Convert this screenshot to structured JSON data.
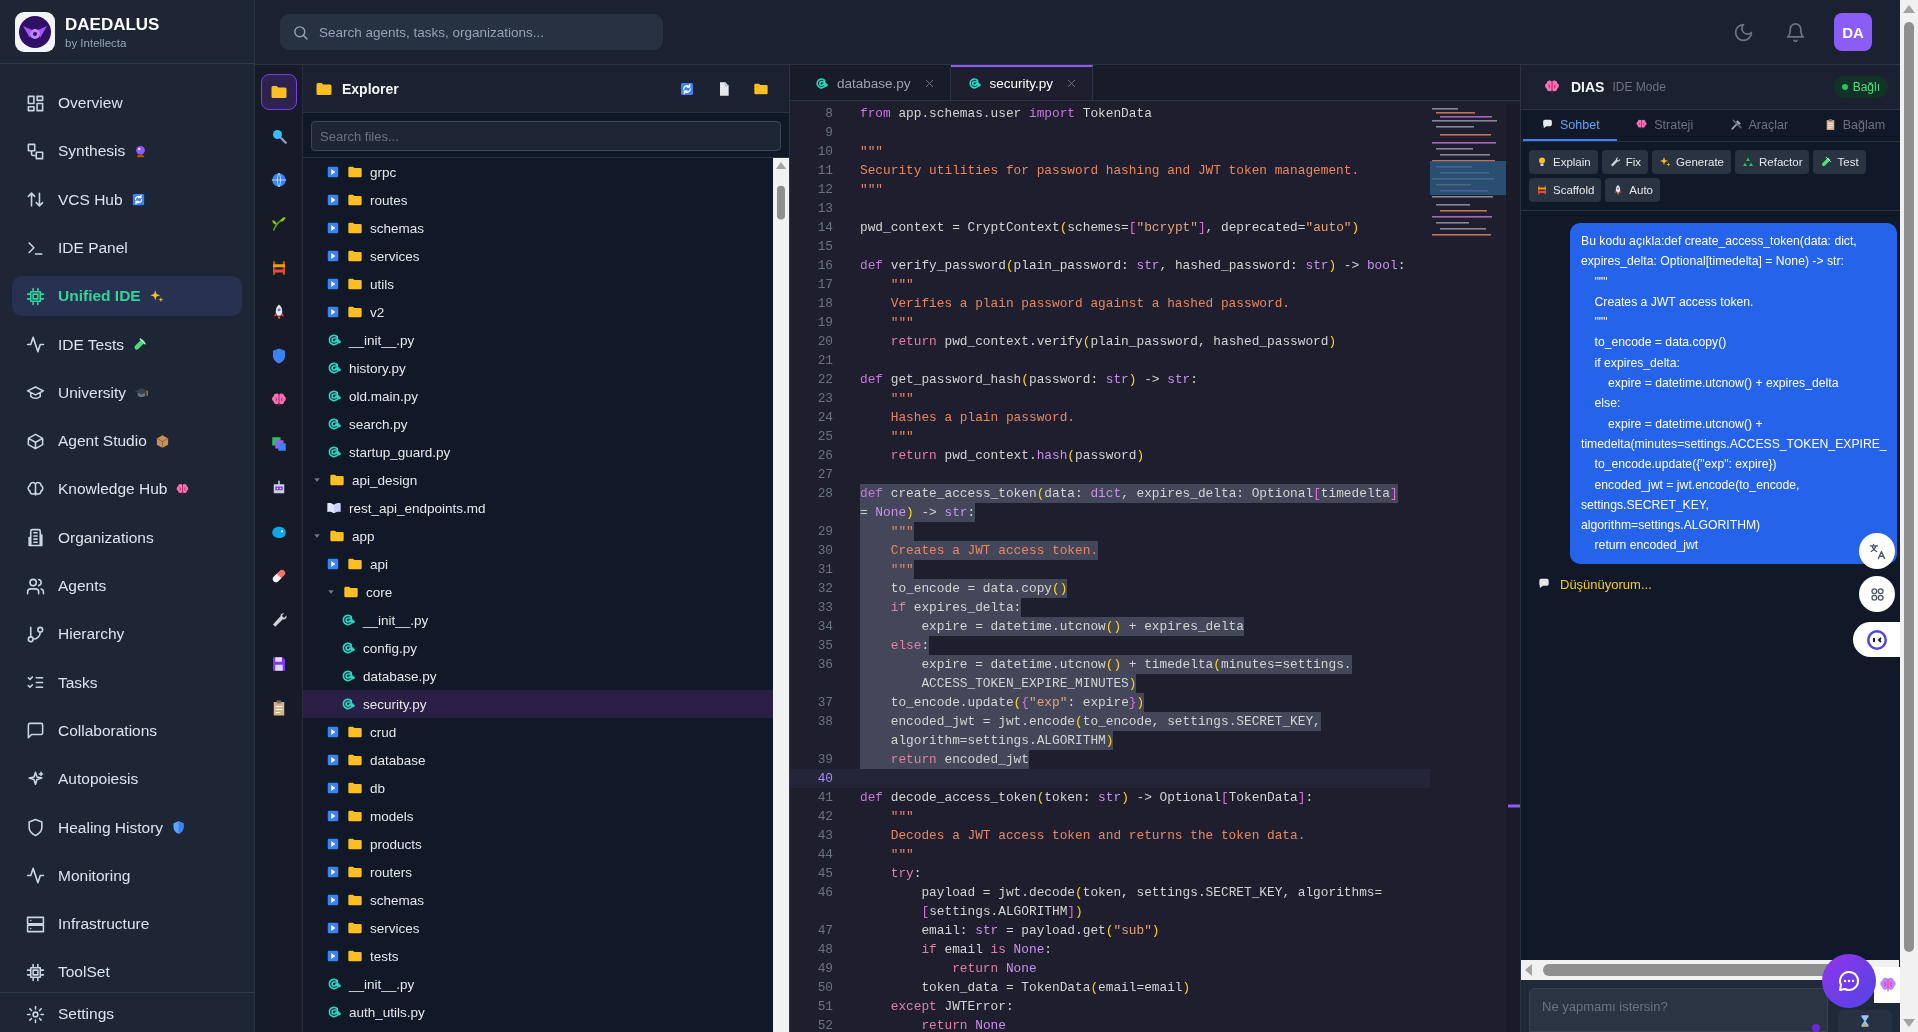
{
  "brand": {
    "name": "DAEDALUS",
    "tagline": "by Intellecta"
  },
  "nav": [
    {
      "label": "Overview",
      "selected": false
    },
    {
      "label": "Synthesis",
      "selected": false
    },
    {
      "label": "VCS Hub",
      "selected": false
    },
    {
      "label": "IDE Panel",
      "selected": false
    },
    {
      "label": "Unified IDE",
      "selected": true
    },
    {
      "label": "IDE Tests",
      "selected": false
    },
    {
      "label": "University",
      "selected": false
    },
    {
      "label": "Agent Studio",
      "selected": false
    },
    {
      "label": "Knowledge Hub",
      "selected": false
    },
    {
      "label": "Organizations",
      "selected": false
    },
    {
      "label": "Agents",
      "selected": false
    },
    {
      "label": "Hierarchy",
      "selected": false
    },
    {
      "label": "Tasks",
      "selected": false
    },
    {
      "label": "Collaborations",
      "selected": false
    },
    {
      "label": "Autopoiesis",
      "selected": false
    },
    {
      "label": "Healing History",
      "selected": false
    },
    {
      "label": "Monitoring",
      "selected": false
    },
    {
      "label": "Infrastructure",
      "selected": false
    },
    {
      "label": "ToolSet",
      "selected": false
    }
  ],
  "settings": {
    "label": "Settings"
  },
  "search": {
    "placeholder": "Search agents, tasks, organizations..."
  },
  "user": {
    "initials": "DA"
  },
  "activity_bar": [
    {
      "selected": true
    },
    {
      "selected": false
    },
    {
      "selected": false
    },
    {
      "selected": false
    },
    {
      "selected": false
    },
    {
      "selected": false
    },
    {
      "selected": false
    },
    {
      "selected": false
    },
    {
      "selected": false
    },
    {
      "selected": false
    },
    {
      "selected": false
    },
    {
      "selected": false
    },
    {
      "selected": false
    },
    {
      "selected": false
    },
    {
      "selected": false
    }
  ],
  "explorer": {
    "title": "Explorer",
    "search": {
      "placeholder": "Search files..."
    },
    "tree_continued": [
      {
        "name": "grpc",
        "kind": "folder",
        "expanded": false,
        "selected": false
      },
      {
        "name": "routes",
        "kind": "folder",
        "expanded": false,
        "selected": false
      },
      {
        "name": "schemas",
        "kind": "folder",
        "expanded": false,
        "selected": false
      },
      {
        "name": "services",
        "kind": "folder",
        "expanded": false,
        "selected": false
      },
      {
        "name": "utils",
        "kind": "folder",
        "expanded": false,
        "selected": false
      },
      {
        "name": "v2",
        "kind": "folder",
        "expanded": false,
        "selected": false
      },
      {
        "name": "__init__.py",
        "kind": "python",
        "selected": false
      },
      {
        "name": "history.py",
        "kind": "python",
        "selected": false
      },
      {
        "name": "old.main.py",
        "kind": "python",
        "selected": false
      },
      {
        "name": "search.py",
        "kind": "python",
        "selected": false
      },
      {
        "name": "startup_guard.py",
        "kind": "python",
        "selected": false
      }
    ],
    "tree": [
      {
        "name": "api_design",
        "kind": "folder",
        "expanded": true,
        "selected": false,
        "children": [
          {
            "name": "rest_api_endpoints.md",
            "kind": "markdown",
            "selected": false
          }
        ]
      },
      {
        "name": "app",
        "kind": "folder",
        "expanded": true,
        "selected": false,
        "children": [
          {
            "name": "api",
            "kind": "folder",
            "expanded": false,
            "selected": false
          },
          {
            "name": "core",
            "kind": "folder",
            "expanded": true,
            "selected": false,
            "children": [
              {
                "name": "__init__.py",
                "kind": "python",
                "selected": false
              },
              {
                "name": "config.py",
                "kind": "python",
                "selected": false
              },
              {
                "name": "database.py",
                "kind": "python",
                "selected": false
              },
              {
                "name": "security.py",
                "kind": "python",
                "selected": true
              }
            ]
          },
          {
            "name": "crud",
            "kind": "folder",
            "expanded": false,
            "selected": false
          },
          {
            "name": "database",
            "kind": "folder",
            "expanded": false,
            "selected": false
          },
          {
            "name": "db",
            "kind": "folder",
            "expanded": false,
            "selected": false
          },
          {
            "name": "models",
            "kind": "folder",
            "expanded": false,
            "selected": false
          },
          {
            "name": "products",
            "kind": "folder",
            "expanded": false,
            "selected": false
          },
          {
            "name": "routers",
            "kind": "folder",
            "expanded": false,
            "selected": false
          },
          {
            "name": "schemas",
            "kind": "folder",
            "expanded": false,
            "selected": false
          },
          {
            "name": "services",
            "kind": "folder",
            "expanded": false,
            "selected": false
          },
          {
            "name": "tests",
            "kind": "folder",
            "expanded": false,
            "selected": false
          },
          {
            "name": "__init__.py",
            "kind": "python",
            "selected": false
          },
          {
            "name": "auth_utils.py",
            "kind": "python",
            "selected": false
          }
        ]
      }
    ]
  },
  "editor": {
    "tabs": [
      {
        "label": "database.py",
        "selected": false
      },
      {
        "label": "security.py",
        "selected": true
      }
    ],
    "lines": [
      {
        "number": "8",
        "selected": false,
        "current": false,
        "tokens": [
          {
            "kind": "keyword",
            "text": "from"
          },
          {
            "kind": "plain",
            "text": " app.schemas.user "
          },
          {
            "kind": "keyword",
            "text": "import"
          },
          {
            "kind": "plain",
            "text": " TokenData"
          }
        ]
      },
      {
        "number": "9",
        "selected": false,
        "current": false
      },
      {
        "number": "10",
        "selected": false,
        "current": false,
        "tokens": [
          {
            "kind": "docstring",
            "text": "\"\"\""
          }
        ]
      },
      {
        "number": "11",
        "selected": false,
        "current": false,
        "tokens": [
          {
            "kind": "docstring",
            "text": "Security utilities for password hashing and JWT token management."
          }
        ]
      },
      {
        "number": "12",
        "selected": false,
        "current": false,
        "tokens": [
          {
            "kind": "docstring",
            "text": "\"\"\""
          }
        ]
      },
      {
        "number": "13",
        "selected": false,
        "current": false
      },
      {
        "number": "14",
        "selected": false,
        "current": false,
        "tokens": [
          {
            "kind": "plain",
            "text": "pwd_context = CryptContext"
          },
          {
            "kind": "paren",
            "text": "("
          },
          {
            "kind": "plain",
            "text": "schemes="
          },
          {
            "kind": "bracket",
            "text": "["
          },
          {
            "kind": "string",
            "text": "\"bcrypt\""
          },
          {
            "kind": "bracket",
            "text": "]"
          },
          {
            "kind": "plain",
            "text": ", deprecated="
          },
          {
            "kind": "string",
            "text": "\"auto\""
          },
          {
            "kind": "paren",
            "text": ")"
          }
        ]
      },
      {
        "number": "15",
        "selected": false,
        "current": false
      },
      {
        "number": "16",
        "selected": false,
        "current": false,
        "tokens": [
          {
            "kind": "keyword",
            "text": "def"
          },
          {
            "kind": "plain",
            "text": " verify_password"
          },
          {
            "kind": "paren",
            "text": "("
          },
          {
            "kind": "plain",
            "text": "plain_password: "
          },
          {
            "kind": "type",
            "text": "str"
          },
          {
            "kind": "plain",
            "text": ", hashed_password: "
          },
          {
            "kind": "type",
            "text": "str"
          },
          {
            "kind": "paren",
            "text": ")"
          },
          {
            "kind": "plain",
            "text": " -> "
          },
          {
            "kind": "type",
            "text": "bool"
          },
          {
            "kind": "plain",
            "text": ":"
          }
        ]
      },
      {
        "number": "17",
        "selected": false,
        "current": false,
        "tokens": [
          {
            "kind": "docstring",
            "text": "    \"\"\""
          }
        ]
      },
      {
        "number": "18",
        "selected": false,
        "current": false,
        "tokens": [
          {
            "kind": "docstring",
            "text": "    Verifies a plain password against a hashed password."
          }
        ]
      },
      {
        "number": "19",
        "selected": false,
        "current": false,
        "tokens": [
          {
            "kind": "docstring",
            "text": "    \"\"\""
          }
        ]
      },
      {
        "number": "20",
        "selected": false,
        "current": false,
        "tokens": [
          {
            "kind": "control",
            "text": "    return"
          },
          {
            "kind": "plain",
            "text": " pwd_context.verify"
          },
          {
            "kind": "paren",
            "text": "("
          },
          {
            "kind": "plain",
            "text": "plain_password, hashed_password"
          },
          {
            "kind": "paren",
            "text": ")"
          }
        ]
      },
      {
        "number": "21",
        "selected": false,
        "current": false
      },
      {
        "number": "22",
        "selected": false,
        "current": false,
        "tokens": [
          {
            "kind": "keyword",
            "text": "def"
          },
          {
            "kind": "plain",
            "text": " get_password_hash"
          },
          {
            "kind": "paren",
            "text": "("
          },
          {
            "kind": "plain",
            "text": "password: "
          },
          {
            "kind": "type",
            "text": "str"
          },
          {
            "kind": "paren",
            "text": ")"
          },
          {
            "kind": "plain",
            "text": " -> "
          },
          {
            "kind": "type",
            "text": "str"
          },
          {
            "kind": "plain",
            "text": ":"
          }
        ]
      },
      {
        "number": "23",
        "selected": false,
        "current": false,
        "tokens": [
          {
            "kind": "docstring",
            "text": "    \"\"\""
          }
        ]
      },
      {
        "number": "24",
        "selected": false,
        "current": false,
        "tokens": [
          {
            "kind": "docstring",
            "text": "    Hashes a plain password."
          }
        ]
      },
      {
        "number": "25",
        "selected": false,
        "current": false,
        "tokens": [
          {
            "kind": "docstring",
            "text": "    \"\"\""
          }
        ]
      },
      {
        "number": "26",
        "selected": false,
        "current": false,
        "tokens": [
          {
            "kind": "control",
            "text": "    return"
          },
          {
            "kind": "plain",
            "text": " pwd_context."
          },
          {
            "kind": "type",
            "text": "hash"
          },
          {
            "kind": "paren",
            "text": "("
          },
          {
            "kind": "plain",
            "text": "password"
          },
          {
            "kind": "paren",
            "text": ")"
          }
        ]
      },
      {
        "number": "27",
        "selected": false,
        "current": false
      },
      {
        "number": "28",
        "selected": true,
        "current": false,
        "tokens": [
          {
            "kind": "keyword",
            "text": "def"
          },
          {
            "kind": "plain",
            "text": " create_access_token"
          },
          {
            "kind": "paren",
            "text": "("
          },
          {
            "kind": "plain",
            "text": "data: "
          },
          {
            "kind": "type",
            "text": "dict"
          },
          {
            "kind": "plain",
            "text": ", expires_delta: Optional"
          },
          {
            "kind": "bracket",
            "text": "["
          },
          {
            "kind": "plain",
            "text": "timedelta"
          },
          {
            "kind": "bracket",
            "text": "]"
          }
        ],
        "continuation": [
          {
            "kind": "plain",
            "text": "= "
          },
          {
            "kind": "type",
            "text": "None"
          },
          {
            "kind": "paren",
            "text": ")"
          },
          {
            "kind": "plain",
            "text": " -> "
          },
          {
            "kind": "type",
            "text": "str"
          },
          {
            "kind": "plain",
            "text": ":"
          }
        ]
      },
      {
        "number": "29",
        "selected": true,
        "current": false,
        "tokens": [
          {
            "kind": "docstring",
            "text": "    \"\"\""
          }
        ]
      },
      {
        "number": "30",
        "selected": true,
        "current": false,
        "tokens": [
          {
            "kind": "docstring",
            "text": "    Creates a JWT access token."
          }
        ]
      },
      {
        "number": "31",
        "selected": true,
        "current": false,
        "tokens": [
          {
            "kind": "docstring",
            "text": "    \"\"\""
          }
        ]
      },
      {
        "number": "32",
        "selected": true,
        "current": false,
        "tokens": [
          {
            "kind": "plain",
            "text": "    to_encode = data.copy"
          },
          {
            "kind": "paren",
            "text": "()"
          }
        ]
      },
      {
        "number": "33",
        "selected": true,
        "current": false,
        "tokens": [
          {
            "kind": "control",
            "text": "    if"
          },
          {
            "kind": "plain",
            "text": " expires_delta:"
          }
        ]
      },
      {
        "number": "34",
        "selected": true,
        "current": false,
        "tokens": [
          {
            "kind": "plain",
            "text": "        expire = datetime.utcnow"
          },
          {
            "kind": "paren",
            "text": "()"
          },
          {
            "kind": "plain",
            "text": " + expires_delta"
          }
        ]
      },
      {
        "number": "35",
        "selected": true,
        "current": false,
        "tokens": [
          {
            "kind": "control",
            "text": "    else"
          },
          {
            "kind": "plain",
            "text": ":"
          }
        ]
      },
      {
        "number": "36",
        "selected": true,
        "current": false,
        "tokens": [
          {
            "kind": "plain",
            "text": "        expire = datetime.utcnow"
          },
          {
            "kind": "paren",
            "text": "()"
          },
          {
            "kind": "plain",
            "text": " + timedelta"
          },
          {
            "kind": "paren",
            "text": "("
          },
          {
            "kind": "plain",
            "text": "minutes=settings."
          }
        ],
        "continuation": [
          {
            "kind": "plain",
            "text": "        ACCESS_TOKEN_EXPIRE_MINUTES"
          },
          {
            "kind": "paren",
            "text": ")"
          }
        ]
      },
      {
        "number": "37",
        "selected": true,
        "current": false,
        "tokens": [
          {
            "kind": "plain",
            "text": "    to_encode.update"
          },
          {
            "kind": "paren",
            "text": "("
          },
          {
            "kind": "bracket",
            "text": "{"
          },
          {
            "kind": "string",
            "text": "\"exp\""
          },
          {
            "kind": "plain",
            "text": ": expire"
          },
          {
            "kind": "bracket",
            "text": "}"
          },
          {
            "kind": "paren",
            "text": ")"
          }
        ]
      },
      {
        "number": "38",
        "selected": true,
        "current": false,
        "tokens": [
          {
            "kind": "plain",
            "text": "    encoded_jwt = jwt.encode"
          },
          {
            "kind": "paren",
            "text": "("
          },
          {
            "kind": "plain",
            "text": "to_encode, settings.SECRET_KEY,"
          }
        ],
        "continuation": [
          {
            "kind": "plain",
            "text": "    algorithm=settings.ALGORITHM"
          },
          {
            "kind": "paren",
            "text": ")"
          }
        ]
      },
      {
        "number": "39",
        "selected": true,
        "current": false,
        "tokens": [
          {
            "kind": "control",
            "text": "    return"
          },
          {
            "kind": "plain",
            "text": " encoded_jwt"
          }
        ]
      },
      {
        "number": "40",
        "selected": false,
        "current": true
      },
      {
        "number": "41",
        "selected": false,
        "current": false,
        "tokens": [
          {
            "kind": "keyword",
            "text": "def"
          },
          {
            "kind": "plain",
            "text": " decode_access_token"
          },
          {
            "kind": "paren",
            "text": "("
          },
          {
            "kind": "plain",
            "text": "token: "
          },
          {
            "kind": "type",
            "text": "str"
          },
          {
            "kind": "paren",
            "text": ")"
          },
          {
            "kind": "plain",
            "text": " -> Optional"
          },
          {
            "kind": "bracket",
            "text": "["
          },
          {
            "kind": "plain",
            "text": "TokenData"
          },
          {
            "kind": "bracket",
            "text": "]"
          },
          {
            "kind": "plain",
            "text": ":"
          }
        ]
      },
      {
        "number": "42",
        "selected": false,
        "current": false,
        "tokens": [
          {
            "kind": "docstring",
            "text": "    \"\"\""
          }
        ]
      },
      {
        "number": "43",
        "selected": false,
        "current": false,
        "tokens": [
          {
            "kind": "docstring",
            "text": "    Decodes a JWT access token and returns the token data."
          }
        ]
      },
      {
        "number": "44",
        "selected": false,
        "current": false,
        "tokens": [
          {
            "kind": "docstring",
            "text": "    \"\"\""
          }
        ]
      },
      {
        "number": "45",
        "selected": false,
        "current": false,
        "tokens": [
          {
            "kind": "control",
            "text": "    try"
          },
          {
            "kind": "plain",
            "text": ":"
          }
        ]
      },
      {
        "number": "46",
        "selected": false,
        "current": false,
        "tokens": [
          {
            "kind": "plain",
            "text": "        payload = jwt.decode"
          },
          {
            "kind": "paren",
            "text": "("
          },
          {
            "kind": "plain",
            "text": "token, settings.SECRET_KEY, algorithms="
          }
        ],
        "continuation": [
          {
            "kind": "bracket",
            "text": "        ["
          },
          {
            "kind": "plain",
            "text": "settings.ALGORITHM"
          },
          {
            "kind": "bracket",
            "text": "]"
          },
          {
            "kind": "paren",
            "text": ")"
          }
        ]
      },
      {
        "number": "47",
        "selected": false,
        "current": false,
        "tokens": [
          {
            "kind": "plain",
            "text": "        email: "
          },
          {
            "kind": "type",
            "text": "str"
          },
          {
            "kind": "plain",
            "text": " = payload.get"
          },
          {
            "kind": "paren",
            "text": "("
          },
          {
            "kind": "string",
            "text": "\"sub\""
          },
          {
            "kind": "paren",
            "text": ")"
          }
        ]
      },
      {
        "number": "48",
        "selected": false,
        "current": false,
        "tokens": [
          {
            "kind": "control",
            "text": "        if"
          },
          {
            "kind": "plain",
            "text": " email "
          },
          {
            "kind": "control",
            "text": "is "
          },
          {
            "kind": "type",
            "text": "None"
          },
          {
            "kind": "plain",
            "text": ":"
          }
        ]
      },
      {
        "number": "49",
        "selected": false,
        "current": false,
        "tokens": [
          {
            "kind": "control",
            "text": "            return "
          },
          {
            "kind": "type",
            "text": "None"
          }
        ]
      },
      {
        "number": "50",
        "selected": false,
        "current": false,
        "tokens": [
          {
            "kind": "plain",
            "text": "        token_data = TokenData"
          },
          {
            "kind": "paren",
            "text": "("
          },
          {
            "kind": "plain",
            "text": "email=email"
          },
          {
            "kind": "paren",
            "text": ")"
          }
        ]
      },
      {
        "number": "51",
        "selected": false,
        "current": false,
        "tokens": [
          {
            "kind": "control",
            "text": "    except"
          },
          {
            "kind": "plain",
            "text": " JWTError:"
          }
        ]
      },
      {
        "number": "52",
        "selected": false,
        "current": false,
        "tokens": [
          {
            "kind": "control",
            "text": "        return "
          },
          {
            "kind": "type",
            "text": "None"
          }
        ]
      }
    ]
  },
  "assistant": {
    "name": "DIAS",
    "mode": "IDE Mode",
    "status": {
      "label": "Bağlı",
      "connected": true
    },
    "tabs": [
      {
        "label": "Sohbet",
        "selected": true
      },
      {
        "label": "Strateji",
        "selected": false
      },
      {
        "label": "Araçlar",
        "selected": false
      },
      {
        "label": "Bağlam",
        "selected": false
      }
    ],
    "actions": [
      "Explain",
      "Fix",
      "Generate",
      "Refactor",
      "Test",
      "Scaffold",
      "Auto"
    ],
    "messages": [
      {
        "kind": "user",
        "text": "Bu kodu açıkla:def create_access_token(data: dict, expires_delta: Optional[timedelta] = None) -> str:\n    \"\"\"\n    Creates a JWT access token.\n    \"\"\"\n    to_encode = data.copy()\n    if expires_delta:\n        expire = datetime.utcnow() + expires_delta\n    else:\n        expire = datetime.utcnow() +\ntimedelta(minutes=settings.ACCESS_TOKEN_EXPIRE_\n    to_encode.update({\"exp\": expire})\n    encoded_jwt = jwt.encode(to_encode,\nsettings.SECRET_KEY,\nalgorithm=settings.ALGORITHM)\n    return encoded_jwt"
      },
      {
        "kind": "thinking",
        "text": "Düşünüyorum..."
      }
    ],
    "input": {
      "placeholder": "Ne yapmamı istersin?"
    }
  }
}
